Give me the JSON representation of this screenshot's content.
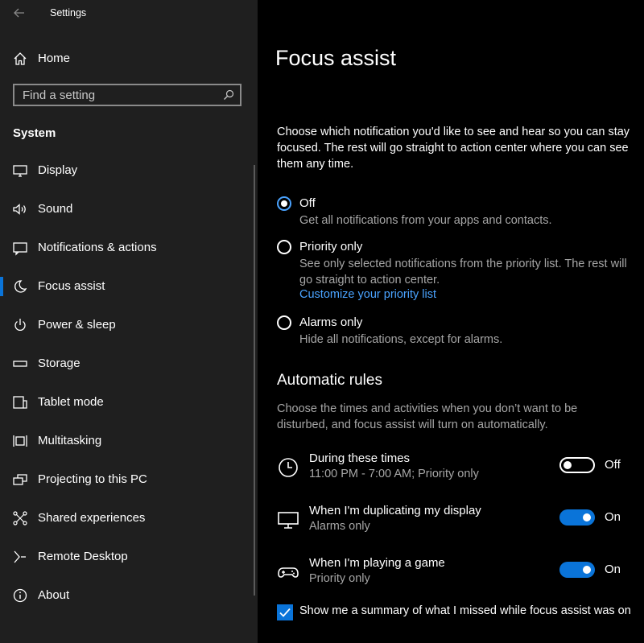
{
  "window": {
    "title": "Settings"
  },
  "sidebar": {
    "home_label": "Home",
    "search": {
      "placeholder": "Find a setting"
    },
    "section": "System",
    "items": [
      {
        "label": "Display",
        "icon": "display-icon"
      },
      {
        "label": "Sound",
        "icon": "speaker-icon"
      },
      {
        "label": "Notifications & actions",
        "icon": "notifications-icon"
      },
      {
        "label": "Focus assist",
        "icon": "moon-icon",
        "selected": true
      },
      {
        "label": "Power & sleep",
        "icon": "power-icon"
      },
      {
        "label": "Storage",
        "icon": "storage-icon"
      },
      {
        "label": "Tablet mode",
        "icon": "tablet-icon"
      },
      {
        "label": "Multitasking",
        "icon": "multitasking-icon"
      },
      {
        "label": "Projecting to this PC",
        "icon": "projecting-icon"
      },
      {
        "label": "Shared experiences",
        "icon": "shared-icon"
      },
      {
        "label": "Remote Desktop",
        "icon": "remote-desktop-icon"
      },
      {
        "label": "About",
        "icon": "info-icon"
      }
    ]
  },
  "main": {
    "title": "Focus assist",
    "intro": "Choose which notification you'd like to see and hear so you can stay focused. The rest will go straight to action center where you can see them any time.",
    "options": [
      {
        "label": "Off",
        "desc": "Get all notifications from your apps and contacts.",
        "checked": true
      },
      {
        "label": "Priority only",
        "desc": "See only selected notifications from the priority list. The rest will go straight to action center.",
        "link": "Customize your priority list",
        "checked": false
      },
      {
        "label": "Alarms only",
        "desc": "Hide all notifications, except for alarms.",
        "checked": false
      }
    ],
    "rules_header": "Automatic rules",
    "rules_desc": "Choose the times and activities when you don’t want to be disturbed, and focus assist will turn on automatically.",
    "rules": [
      {
        "title": "During these times",
        "sub": "11:00 PM - 7:00 AM; Priority only",
        "state": "Off",
        "icon": "clock-icon"
      },
      {
        "title": "When I'm duplicating my display",
        "sub": "Alarms only",
        "state": "On",
        "icon": "monitor-icon"
      },
      {
        "title": "When I'm playing a game",
        "sub": "Priority only",
        "state": "On",
        "icon": "gamepad-icon"
      }
    ],
    "summary_checkbox": {
      "label": "Show me a summary of what I missed while focus assist was on",
      "checked": true
    }
  },
  "colors": {
    "accent": "#0a74d9",
    "link": "#4aa3ff",
    "sidebar_bg": "#1f1f1f",
    "main_bg": "#000000",
    "secondary_text": "#a6a6a6"
  }
}
